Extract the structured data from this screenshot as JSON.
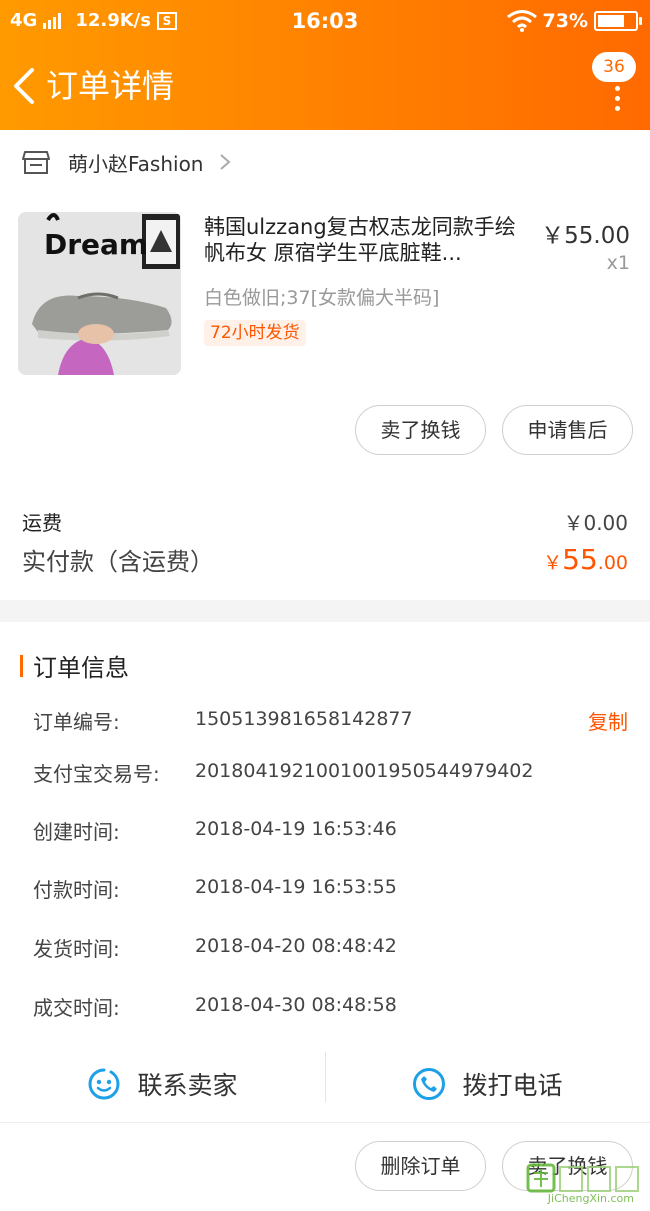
{
  "status_bar": {
    "network": "4G",
    "speed": "12.9K/s",
    "time": "16:03",
    "battery": "73%",
    "battery_level": 0.73
  },
  "nav": {
    "title": "订单详情",
    "badge": "36"
  },
  "store": {
    "name": "萌小赵Fashion"
  },
  "product": {
    "title": "韩国ulzzang复古权志龙同款手绘帆布女 原宿学生平底脏鞋...",
    "price": "￥55.00",
    "qty": "x1",
    "sku": "白色做旧;37[女款偏大半码]",
    "tag": "72小时发货",
    "image_text": "Dream"
  },
  "actions": {
    "sell": "卖了换钱",
    "after_sale": "申请售后"
  },
  "summary": {
    "freight_label": "运费",
    "freight_value": "￥0.00",
    "paid_label": "实付款（含运费）",
    "paid_currency": "￥",
    "paid_int": "55",
    "paid_dec": ".00"
  },
  "order_info": {
    "title": "订单信息",
    "copy": "复制",
    "rows": [
      {
        "label": "订单编号:",
        "value": "150513981658142877"
      },
      {
        "label": "支付宝交易号:",
        "value": "2018041921001001950544979402"
      },
      {
        "label": "创建时间:",
        "value": "2018-04-19 16:53:46"
      },
      {
        "label": "付款时间:",
        "value": "2018-04-19 16:53:55"
      },
      {
        "label": "发货时间:",
        "value": "2018-04-20 08:48:42"
      },
      {
        "label": "成交时间:",
        "value": "2018-04-30 08:48:58"
      }
    ]
  },
  "contact": {
    "seller": "联系卖家",
    "call": "拨打电话"
  },
  "bottom": {
    "delete": "删除订单",
    "sell": "卖了换钱"
  },
  "watermark": {
    "text": "JiChengXin.com"
  },
  "colors": {
    "header_start": "#ff9a00",
    "header_end": "#ff6a00",
    "accent": "#ff5500"
  }
}
